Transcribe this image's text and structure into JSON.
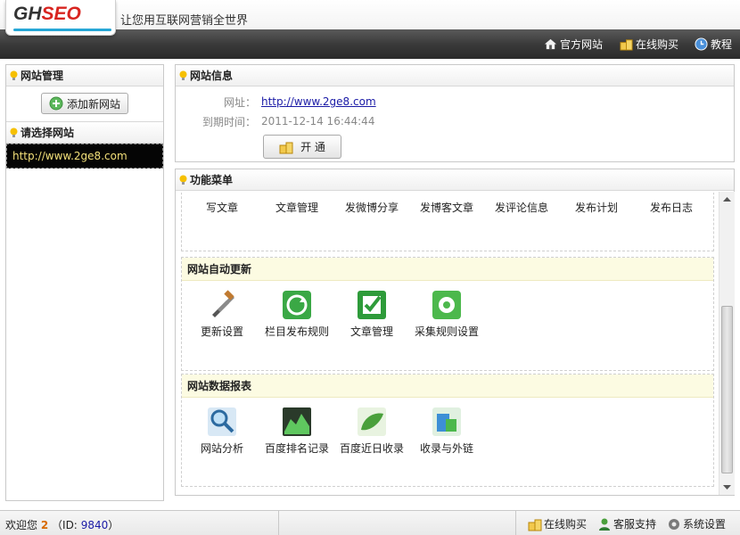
{
  "header": {
    "logo": {
      "part1": "GH",
      "part2": "SEO"
    },
    "slogan": "让您用互联网营销全世界",
    "links": [
      "官方网站",
      "在线购买",
      "教程"
    ]
  },
  "sidebar": {
    "manage_title": "网站管理",
    "add_button": "添加新网站",
    "select_title": "请选择网站",
    "sites": [
      "http://www.2ge8.com"
    ]
  },
  "site_info": {
    "title": "网站信息",
    "url_label": "网址：",
    "url": "http://www.2ge8.com",
    "expire_label": "到期时间：",
    "expire": "2011-12-14 16:44:44",
    "open_button": "开 通"
  },
  "menu": {
    "title": "功能菜单",
    "publish_items": [
      "写文章",
      "文章管理",
      "发微博分享",
      "发博客文章",
      "发评论信息",
      "发布计划",
      "发布日志"
    ],
    "auto_update": {
      "title": "网站自动更新",
      "items": [
        "更新设置",
        "栏目发布规则",
        "文章管理",
        "采集规则设置"
      ]
    },
    "reports": {
      "title": "网站数据报表",
      "items": [
        "网站分析",
        "百度排名记录",
        "百度近日收录",
        "收录与外链"
      ]
    }
  },
  "status": {
    "welcome": "欢迎您",
    "count": "2",
    "id_prefix": "（ID:",
    "id": "9840",
    "id_suffix": "）",
    "buttons": [
      "在线购买",
      "客服支持",
      "系统设置"
    ]
  },
  "colors": {
    "accent_yellow": "#f3e079",
    "link_blue": "#1a1aa6",
    "section_bg": "#fcfbe2",
    "logo_red": "#d8241f",
    "logo_cyan": "#27a7d6"
  }
}
